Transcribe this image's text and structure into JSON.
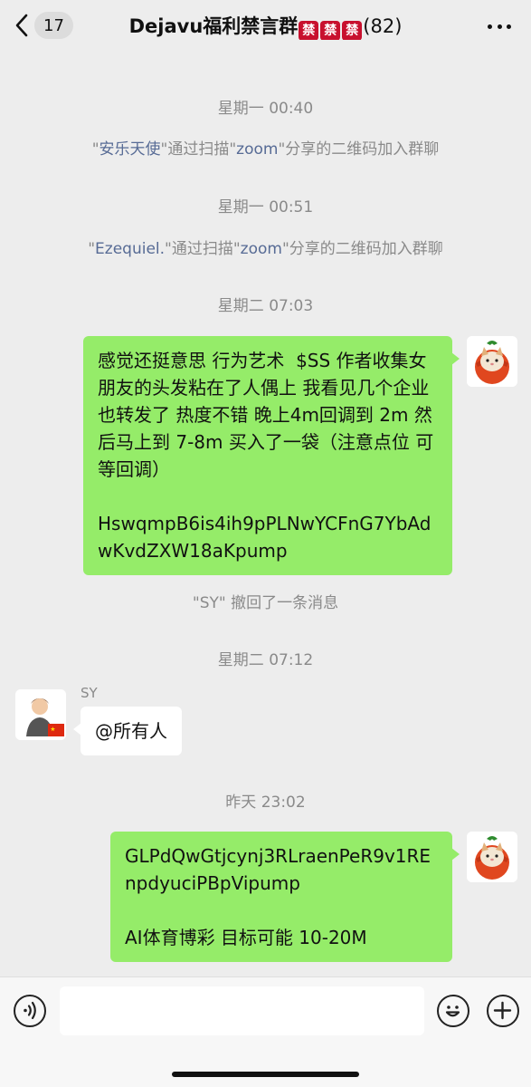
{
  "header": {
    "back_count": "17",
    "title_prefix": "Dejavu福利禁言群",
    "ban_char": "禁",
    "member_count": "(82)"
  },
  "messages": {
    "time1": "星期一 00:40",
    "sys1": {
      "q1": "\"",
      "name": "安乐天使",
      "mid": "\"通过扫描\"",
      "via": "zoom",
      "tail": "\"分享的二维码加入群聊"
    },
    "time2": "星期一 00:51",
    "sys2": {
      "q1": "\"",
      "name": "Ezequiel.",
      "mid": "\"通过扫描\"",
      "via": "zoom",
      "tail": "\"分享的二维码加入群聊"
    },
    "time3": "星期二 07:03",
    "bubble1": "感觉还挺意思 行为艺术  $SS 作者收集女朋友的头发粘在了人偶上 我看见几个企业也转发了 热度不错 晚上4m回调到 2m 然后马上到 7-8m 买入了一袋（注意点位 可等回调）\n\nHswqmpB6is4ih9pPLNwYCFnG7YbAdwKvdZXW18aKpump",
    "recall": "\"SY\" 撤回了一条消息",
    "time4": "星期二 07:12",
    "sender_sy": "SY",
    "bubble2": "@所有人",
    "time5": "昨天 23:02",
    "bubble3": "GLPdQwGtjcynj3RLraenPeR9v1REnpdyuciPBpVipump\n\nAI体育博彩 目标可能 10-20M"
  },
  "input": {
    "placeholder": ""
  },
  "icons": [
    "chevron-left-icon",
    "more-icon",
    "voice-icon",
    "emoji-icon",
    "plus-icon"
  ],
  "colors": {
    "bubble_mine": "#95ec69",
    "link_name": "#576b95",
    "ban_badge": "#c8102e"
  }
}
